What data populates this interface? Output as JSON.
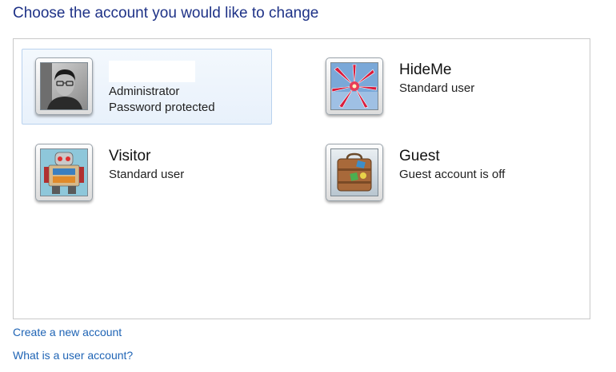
{
  "heading": "Choose the account you would like to change",
  "accounts": [
    {
      "name": "",
      "type": "Administrator",
      "status": "Password protected",
      "picture_icon": "person-photo-icon",
      "selected": true
    },
    {
      "name": "HideMe",
      "type": "Standard user",
      "picture_icon": "red-flower-icon"
    },
    {
      "name": "Visitor",
      "type": "Standard user",
      "picture_icon": "robot-icon"
    },
    {
      "name": "Guest",
      "type": "Guest account is off",
      "picture_icon": "suitcase-icon"
    }
  ],
  "links": {
    "create": "Create a new account",
    "help": "What is a user account?"
  },
  "colors": {
    "heading": "#1e3287",
    "link": "#1f64b5",
    "selected_bg": "#e8f1fb",
    "selected_border": "#b9d2ee"
  }
}
